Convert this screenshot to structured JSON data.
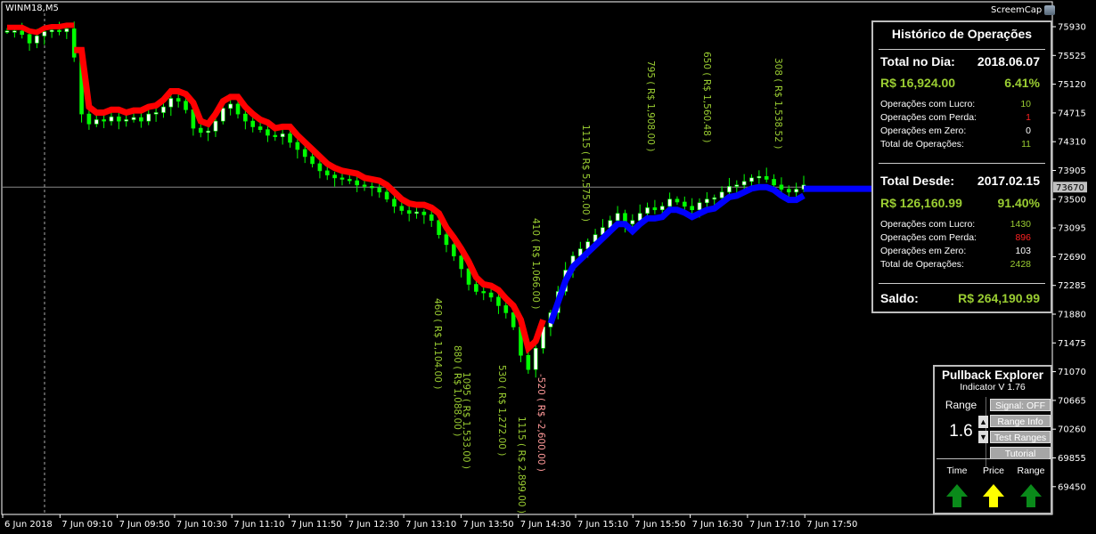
{
  "window": {
    "symbol": "WINM18,M5",
    "screencap_label": "ScreemCap"
  },
  "history": {
    "title": "Histórico de Operações",
    "day": {
      "label": "Total no Dia:",
      "date": "2018.06.07",
      "amount": "R$ 16,924.00",
      "percent": "6.41%",
      "rows": [
        {
          "label": "Operações com Lucro:",
          "value": "10",
          "color": "#9acd32"
        },
        {
          "label": "Operações com Perda:",
          "value": "1",
          "color": "#ff2222"
        },
        {
          "label": "Operações em Zero:",
          "value": "0",
          "color": "#ffffff"
        },
        {
          "label": "Total de Operações:",
          "value": "11",
          "color": "#9acd32"
        }
      ]
    },
    "since": {
      "label": "Total Desde:",
      "date": "2017.02.15",
      "amount": "R$ 126,160.99",
      "percent": "91.40%",
      "rows": [
        {
          "label": "Operações com Lucro:",
          "value": "1430",
          "color": "#9acd32"
        },
        {
          "label": "Operações com Perda:",
          "value": "896",
          "color": "#ff2222"
        },
        {
          "label": "Operações em Zero:",
          "value": "103",
          "color": "#ffffff"
        },
        {
          "label": "Total de Operações:",
          "value": "2428",
          "color": "#9acd32"
        }
      ]
    },
    "balance": {
      "label": "Saldo:",
      "value": "R$ 264,190.99"
    }
  },
  "pullback": {
    "title": "Pullback Explorer",
    "subtitle": "Indicator V 1.76",
    "range_label": "Range",
    "range_value": "1.6",
    "buttons": [
      "Signal: OFF",
      "Range Info",
      "Test Ranges",
      "Tutorial"
    ],
    "indicators": [
      {
        "label": "Time",
        "color": "#0a8a1a"
      },
      {
        "label": "Price",
        "color": "#ffff00"
      },
      {
        "label": "Range",
        "color": "#0a8a1a"
      }
    ]
  },
  "chart_data": {
    "type": "candlestick",
    "price_axis": [
      "75930",
      "75525",
      "75120",
      "74715",
      "74310",
      "73905",
      "73500",
      "73095",
      "72690",
      "72285",
      "71880",
      "71475",
      "71070",
      "70665",
      "70260",
      "69855",
      "69450"
    ],
    "current_price": "73670",
    "time_axis": [
      "6 Jun 2018",
      "7 Jun 09:10",
      "7 Jun 09:50",
      "7 Jun 10:30",
      "7 Jun 11:10",
      "7 Jun 11:50",
      "7 Jun 12:30",
      "7 Jun 13:10",
      "7 Jun 13:50",
      "7 Jun 14:30",
      "7 Jun 15:10",
      "7 Jun 15:50",
      "7 Jun 16:30",
      "7 Jun 17:10",
      "7 Jun 17:50"
    ],
    "trade_labels": [
      {
        "text": "460 ( R$ 1,104.00 )",
        "color": "#9acd32"
      },
      {
        "text": "880 ( R$ 1,088.00 )",
        "color": "#9acd32"
      },
      {
        "text": "1095 ( R$ 1,533.00 )",
        "color": "#9acd32"
      },
      {
        "text": "530 ( R$ 1,272.00 )",
        "color": "#9acd32"
      },
      {
        "text": "1115 ( R$ 2,899.00 )",
        "color": "#9acd32"
      },
      {
        "text": "-520 ( R$ -2,600.00 )",
        "color": "#ff9999"
      },
      {
        "text": "410 ( R$ 1,066.00 )",
        "color": "#9acd32"
      },
      {
        "text": "1115 ( R$ 5,575.00 )",
        "color": "#9acd32"
      },
      {
        "text": "795 ( R$ 1,908.00 )",
        "color": "#9acd32"
      },
      {
        "text": "650 ( R$ 1,560.48 )",
        "color": "#9acd32"
      },
      {
        "text": "308 ( R$ 1,538.52 )",
        "color": "#9acd32"
      }
    ],
    "series": [
      75870,
      75870,
      75820,
      75700,
      75800,
      75860,
      75880,
      75860,
      75900,
      75500,
      74700,
      74560,
      74620,
      74600,
      74660,
      74600,
      74620,
      74650,
      74600,
      74700,
      74720,
      74800,
      74920,
      74880,
      74760,
      74500,
      74440,
      74460,
      74600,
      74780,
      74840,
      74700,
      74600,
      74520,
      74480,
      74400,
      74380,
      74420,
      74300,
      74200,
      74100,
      74000,
      73900,
      73840,
      73800,
      73780,
      73760,
      73700,
      73680,
      73660,
      73600,
      73500,
      73400,
      73340,
      73300,
      73320,
      73280,
      73200,
      73000,
      72860,
      72700,
      72520,
      72300,
      72200,
      72180,
      72120,
      72000,
      71900,
      71700,
      71300,
      71100,
      71400,
      71700,
      71900,
      72200,
      72500,
      72700,
      72800,
      72900,
      73000,
      73100,
      73200,
      73300,
      73150,
      73200,
      73300,
      73380,
      73350,
      73400,
      73500,
      73460,
      73400,
      73350,
      73450,
      73500,
      73520,
      73600,
      73680,
      73700,
      73750,
      73800,
      73820,
      73780,
      73700,
      73640,
      73600,
      73640,
      73700
    ]
  }
}
